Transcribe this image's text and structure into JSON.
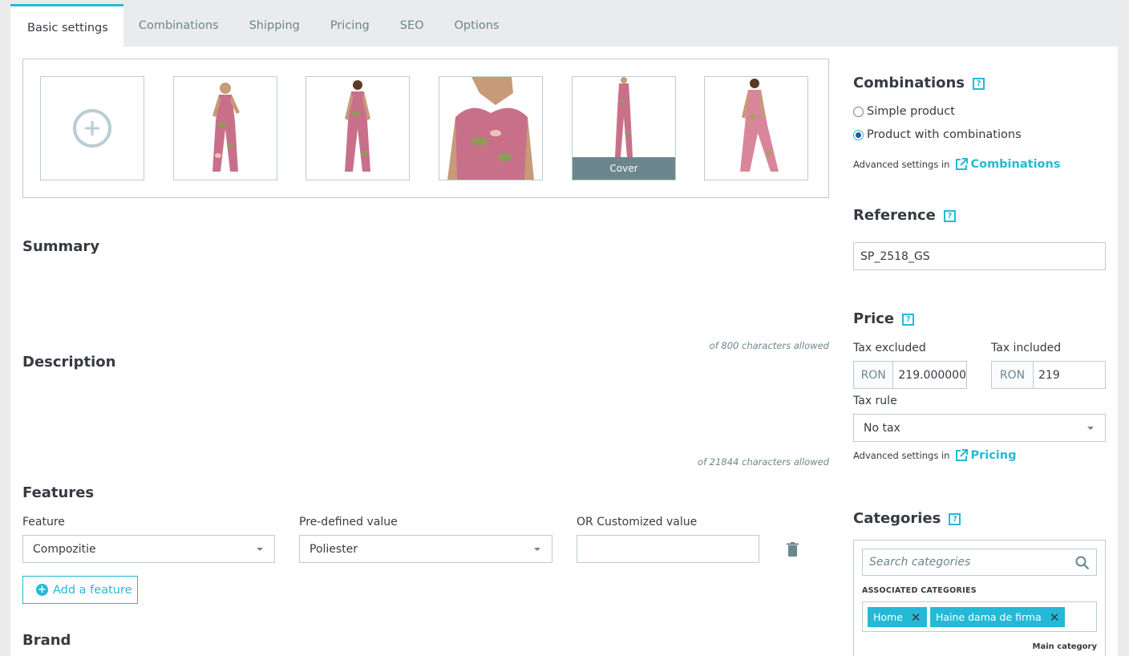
{
  "tabs": [
    {
      "label": "Basic settings"
    },
    {
      "label": "Combinations"
    },
    {
      "label": "Shipping"
    },
    {
      "label": "Pricing"
    },
    {
      "label": "SEO"
    },
    {
      "label": "Options"
    }
  ],
  "images": {
    "cover_label": "Cover"
  },
  "summary": {
    "title": "Summary",
    "hint": "of 800 characters allowed"
  },
  "description": {
    "title": "Description",
    "hint": "of 21844 characters allowed"
  },
  "features": {
    "title": "Features",
    "feature_label": "Feature",
    "predefined_label": "Pre-defined value",
    "custom_label": "OR Customized value",
    "feature_value": "Compozitie",
    "predefined_value": "Poliester",
    "custom_value": "",
    "add_button": "Add a feature"
  },
  "brand": {
    "title": "Brand"
  },
  "combinations": {
    "title": "Combinations",
    "option_simple": "Simple product",
    "option_combo": "Product with combinations",
    "advanced_text": "Advanced settings in",
    "advanced_link": "Combinations"
  },
  "reference": {
    "title": "Reference",
    "value": "SP_2518_GS"
  },
  "price": {
    "title": "Price",
    "tax_excluded_label": "Tax excluded",
    "tax_included_label": "Tax included",
    "currency": "RON",
    "tax_excluded_value": "219.000000",
    "tax_included_value": "219",
    "tax_rule_label": "Tax rule",
    "tax_rule_value": "No tax",
    "advanced_text": "Advanced settings in",
    "advanced_link": "Pricing"
  },
  "categories": {
    "title": "Categories",
    "search_placeholder": "Search categories",
    "associated_label": "ASSOCIATED CATEGORIES",
    "tags": [
      "Home",
      "Haine dama de firma"
    ],
    "main_category_label": "Main category"
  },
  "colors": {
    "accent": "#25b9d7",
    "text": "#363a41",
    "muted": "#6c868e",
    "border": "#bbcdd2"
  }
}
